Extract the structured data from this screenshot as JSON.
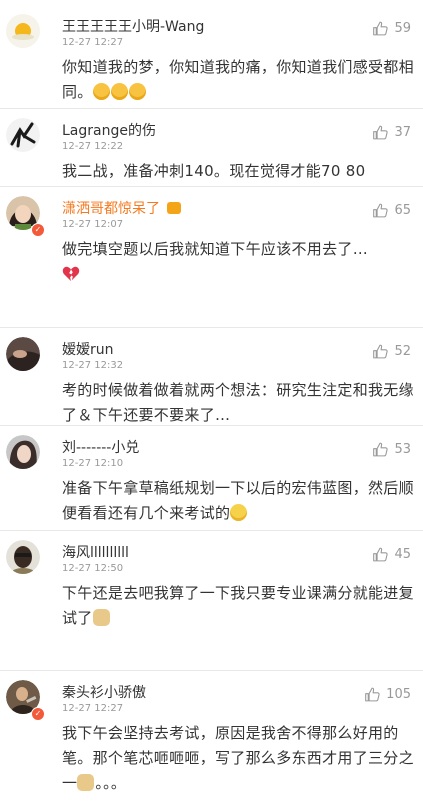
{
  "icons": {
    "like": "thumbs-up-icon"
  },
  "comments": [
    {
      "name": "王王王王王小明-Wang",
      "time": "12-27 12:27",
      "likes": "59",
      "text": "你知道我的梦，你知道我的痛，你知道我们感受都相同。",
      "emojis": [
        "laugh-emoji",
        "laugh-emoji",
        "laugh-emoji"
      ]
    },
    {
      "name": "Lagrange的伤",
      "time": "12-27 12:22",
      "likes": "37",
      "text": "我二战，准备冲刺140。现在觉得才能70 80"
    },
    {
      "name": "潇洒哥都惊呆了",
      "time": "12-27 12:07",
      "likes": "65",
      "text": "做完填空题以后我就知道下午应该不用去了…",
      "emojis": [
        "broken-heart-emoji"
      ]
    },
    {
      "name": "嫒嫒run",
      "time": "12-27 12:32",
      "likes": "52",
      "text": "考的时候做着做着就两个想法：研究生注定和我无缘了＆下午还要不要来了…"
    },
    {
      "name": "刘-------小兑",
      "time": "12-27 12:10",
      "likes": "53",
      "text": "准备下午拿草稿纸规划一下以后的宏伟蓝图，然后顺便看看还有几个来考试的",
      "emojis": [
        "smile-emoji"
      ]
    },
    {
      "name": "海风llllllllll",
      "time": "12-27 12:50",
      "likes": "45",
      "text": "下午还是去吧我算了一下我只要专业课满分就能进复试了",
      "emojis": [
        "doge-emoji"
      ]
    },
    {
      "name": "秦头衫小骄傲",
      "time": "12-27 12:27",
      "likes": "105",
      "text": "我下午会坚持去考试，原因是我舍不得那么好用的笔。那个笔芯咂咂咂，写了那么多东西才用了三分之一",
      "tail": "。。。",
      "emojis": [
        "doge-emoji"
      ]
    }
  ]
}
